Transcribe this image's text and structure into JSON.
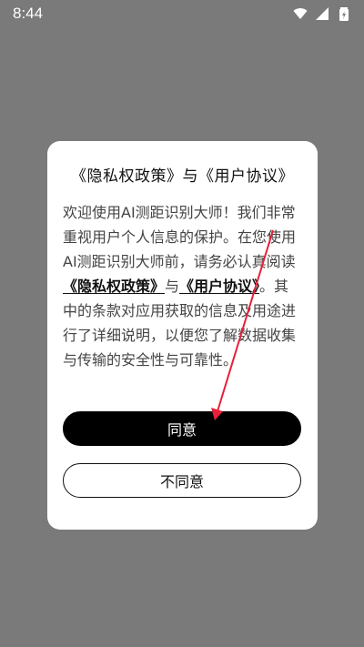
{
  "status_bar": {
    "time": "8:44",
    "icons": [
      "wifi-icon",
      "signal-icon",
      "battery-icon"
    ]
  },
  "dialog": {
    "title": "《隐私权政策》与《用户协议》",
    "body": {
      "part1": "欢迎使用AI测距识别大师！我们非常重视用户个人信息的保护。在您使用AI测距识别大师前，请务必认真阅读",
      "privacy_link": "《隐私权政策》",
      "connector": "与",
      "agreement_link": "《用户协议》",
      "part2": "。其中的条款对应用获取的信息及用途进行了详细说明，以便您了解数据收集与传输的安全性与可靠性。"
    },
    "agree_button": "同意",
    "disagree_button": "不同意"
  },
  "colors": {
    "overlay": "#7a7a7a",
    "dialog_bg": "#ffffff",
    "primary_button": "#000000",
    "annotation_arrow": "#e8203a"
  }
}
